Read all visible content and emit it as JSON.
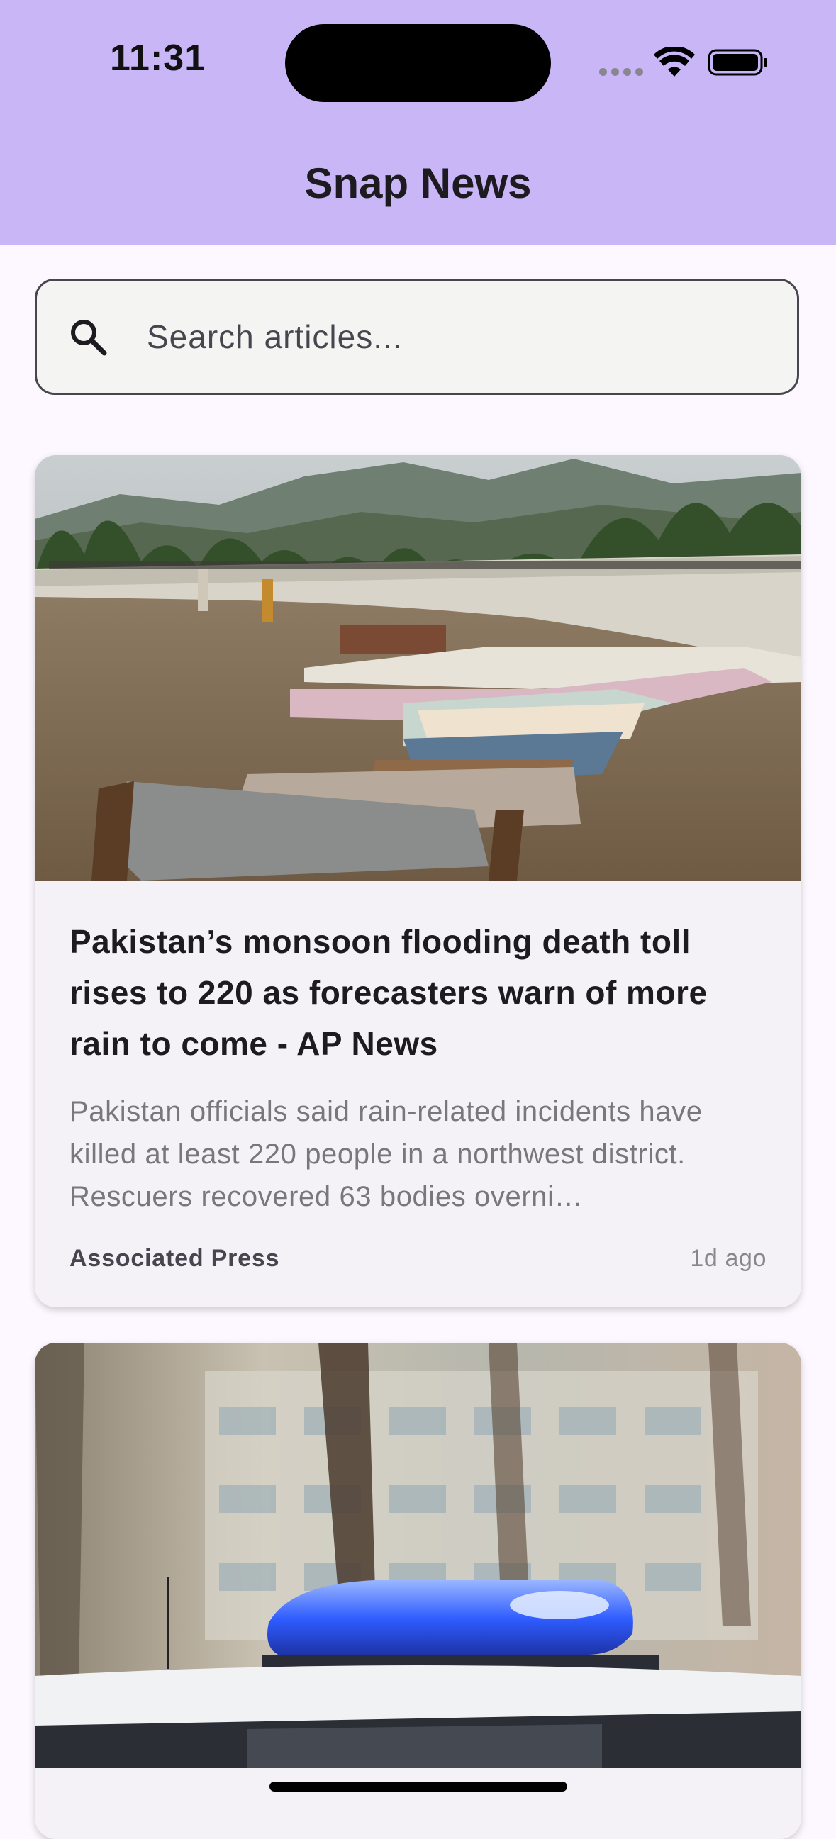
{
  "status_bar": {
    "time": "11:31"
  },
  "header": {
    "title": "Snap News",
    "background": "#c8b6f7"
  },
  "search": {
    "placeholder": "Search articles...",
    "value": "",
    "icon": "search-icon"
  },
  "articles": [
    {
      "image_alt": "Rows of shrouded bodies on wooden charpoy beds in a field as a large crowd prays in front of green hills",
      "title": "Pakistan’s monsoon flooding death toll rises to 220 as forecasters warn of more rain to come - AP News",
      "description": "Pakistan officials said rain-related incidents have killed at least 220 people in a northwest district. Rescuers recovered 63 bodies overni…",
      "source": "Associated Press",
      "time": "1d ago"
    },
    {
      "image_alt": "Blue flashing police light bar on top of a white patrol car with blurred trees and buildings behind",
      "title": "",
      "description": "",
      "source": "",
      "time": ""
    }
  ]
}
